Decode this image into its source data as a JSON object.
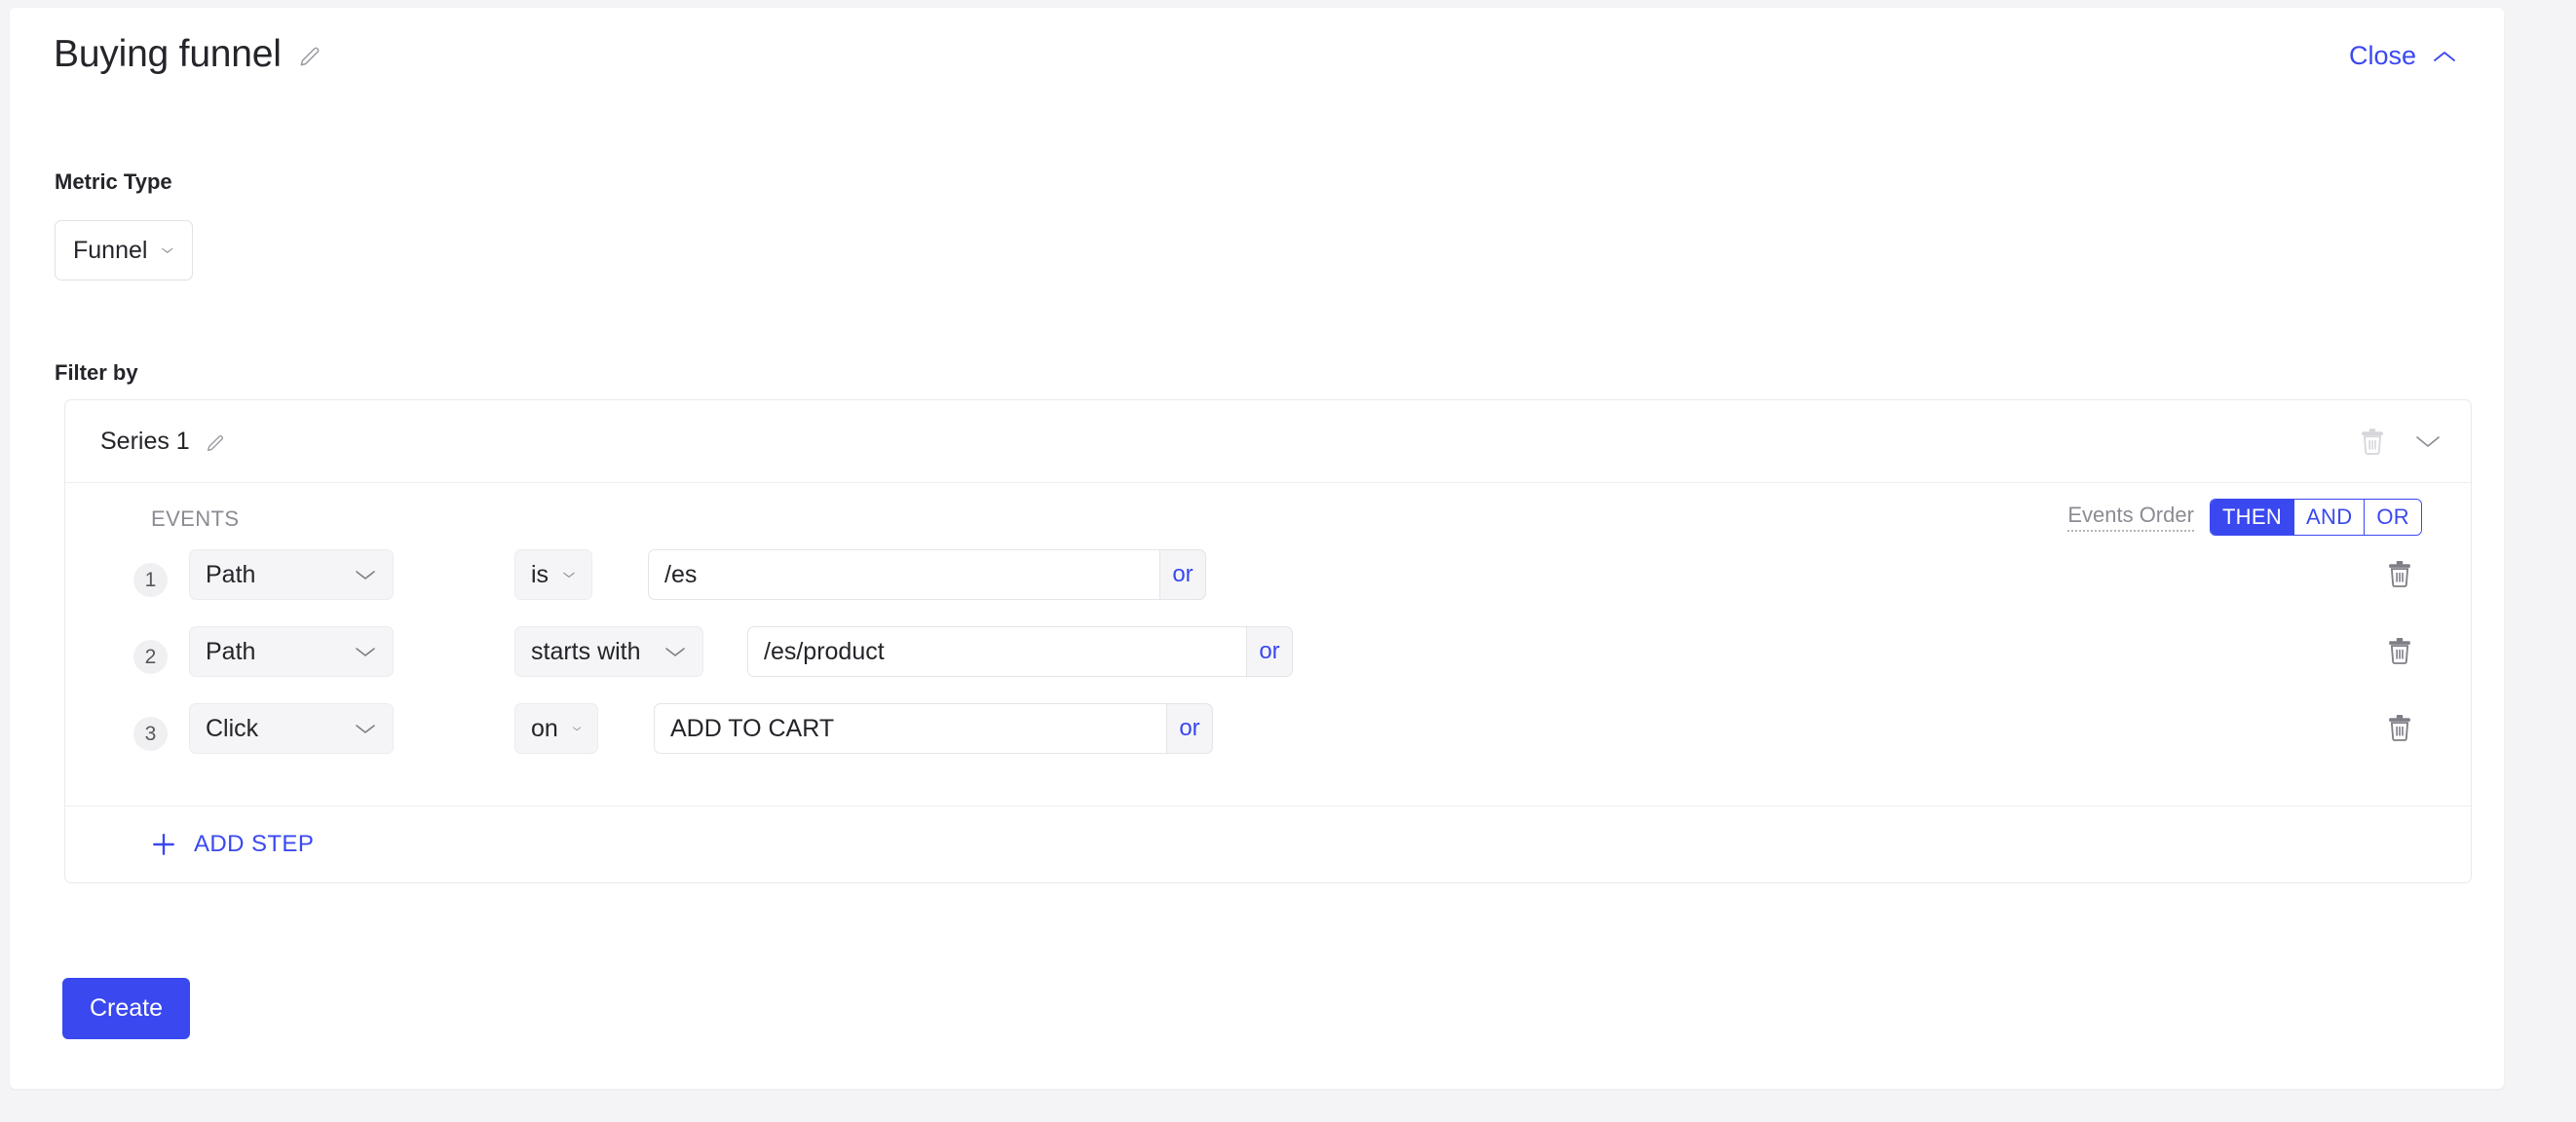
{
  "header": {
    "title": "Buying funnel",
    "edit_icon": "pencil-icon",
    "close_label": "Close",
    "close_icon": "chevron-up-icon"
  },
  "metric_type": {
    "label": "Metric Type",
    "value": "Funnel",
    "chevron_icon": "chevron-down-icon"
  },
  "filter_by": {
    "label": "Filter by",
    "series": {
      "name": "Series 1",
      "edit_icon": "pencil-icon",
      "delete_icon": "trash-icon",
      "collapse_icon": "chevron-down-icon"
    },
    "events": {
      "title": "EVENTS",
      "order_label": "Events Order",
      "order_options": [
        "THEN",
        "AND",
        "OR"
      ],
      "order_selected": "THEN",
      "rows": [
        {
          "step": "1",
          "event": "Path",
          "operator": "is",
          "value": "/es",
          "value_placeholder": "",
          "or_label": "or",
          "delete_icon": "trash-icon"
        },
        {
          "step": "2",
          "event": "Path",
          "operator": "starts with",
          "value": "/es/product",
          "value_placeholder": "",
          "or_label": "or",
          "delete_icon": "trash-icon"
        },
        {
          "step": "3",
          "event": "Click",
          "operator": "on",
          "value": "ADD TO CART",
          "value_placeholder": "",
          "or_label": "or",
          "delete_icon": "trash-icon"
        }
      ],
      "add_step_label": "ADD STEP",
      "add_step_icon": "plus-icon"
    }
  },
  "footer": {
    "create_label": "Create"
  },
  "colors": {
    "accent": "#3a48f0",
    "page_bg": "#f4f4f6",
    "card_bg": "#ffffff",
    "pill_bg": "#f5f5f7",
    "muted_text": "#8b8b93"
  }
}
